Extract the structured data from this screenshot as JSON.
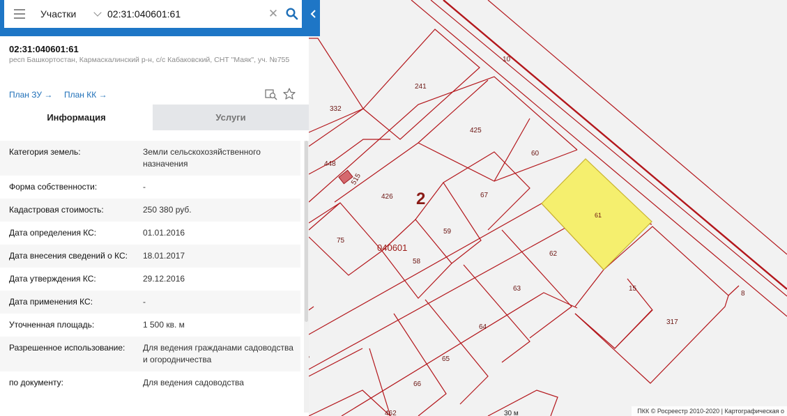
{
  "search": {
    "layer_label": "Участки",
    "query": "02:31:040601:61",
    "icons": {
      "menu": "hamburger-icon",
      "dropdown": "chevron-down-icon",
      "clear": "close-icon",
      "search": "magnifier-icon",
      "collapse": "chevron-left-icon"
    }
  },
  "parcel": {
    "cadastral_number": "02:31:040601:61",
    "address": "респ Башкортостан, Кармаскалинский р-н, с/с Кабаковский, СНТ \"Маяк\", уч. №755",
    "links": [
      "План ЗУ →",
      "План КК →"
    ],
    "tool_icons": [
      "zoom-to-icon",
      "star-icon"
    ]
  },
  "tabs": [
    {
      "label": "Информация",
      "active": true
    },
    {
      "label": "Услуги",
      "active": false
    }
  ],
  "info_rows": [
    {
      "label": "Категория земель:",
      "value": "Земли сельскохозяйственного назначения"
    },
    {
      "label": "Форма собственности:",
      "value": "-"
    },
    {
      "label": "Кадастровая стоимость:",
      "value": "250 380 руб."
    },
    {
      "label": "Дата определения КС:",
      "value": "01.01.2016"
    },
    {
      "label": "Дата внесения сведений о КС:",
      "value": "18.01.2017"
    },
    {
      "label": "Дата утверждения КС:",
      "value": "29.12.2016"
    },
    {
      "label": "Дата применения КС:",
      "value": "-"
    },
    {
      "label": "Уточненная площадь:",
      "value": "1 500 кв. м"
    },
    {
      "label": "Разрешенное использование:",
      "value": "Для ведения гражданами садоводства и огородничества"
    },
    {
      "label": "по документу:",
      "value": "Для ведения садоводства"
    }
  ],
  "map": {
    "highlight_color": "#f5ef6e",
    "line_color": "#b3161b",
    "quarter_label": "2",
    "block_label": "040601",
    "plot_numbers": [
      "10",
      "241",
      "332",
      "425",
      "60",
      "448",
      "515",
      "426",
      "67",
      "61",
      "75",
      "59",
      "62",
      "58",
      "63",
      "15",
      "8",
      "317",
      "64",
      "65",
      "66",
      "462",
      "30 м",
      "60"
    ],
    "attribution": "ПКК © Росреестр 2010-2020 | Картографическая о"
  }
}
